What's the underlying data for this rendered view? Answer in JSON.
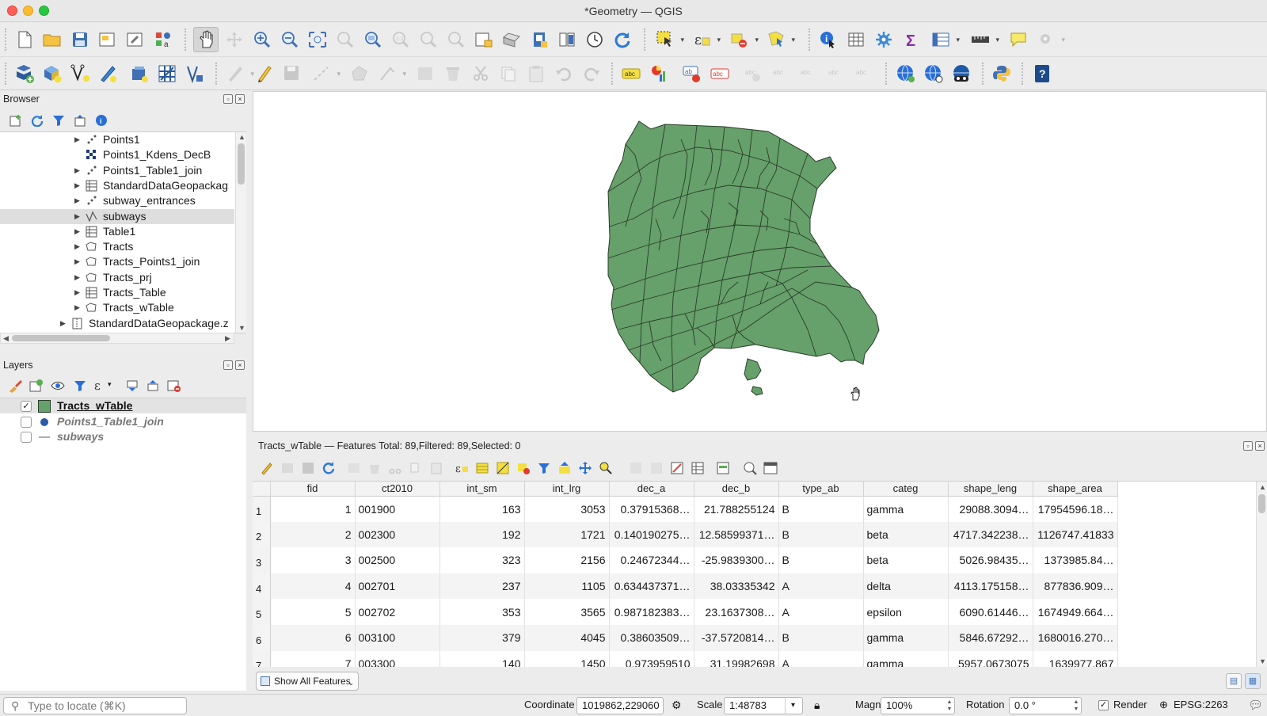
{
  "window": {
    "title": "*Geometry — QGIS"
  },
  "colors": {
    "polygon_fill": "#66a06a",
    "polygon_stroke": "#2a3d2a",
    "selection_bg": "#dedede",
    "accent": "#4a77b5"
  },
  "toolbar1": {
    "icons": [
      "new-project-icon",
      "open-project-icon",
      "save-project-icon",
      "new-print-layout-icon",
      "layout-manager-icon",
      "style-manager-icon",
      "pan-map-icon",
      "pan-to-selection-icon",
      "zoom-in-icon",
      "zoom-out-icon",
      "zoom-full-icon",
      "zoom-to-selection-icon",
      "zoom-to-layer-icon",
      "zoom-native-icon",
      "zoom-last-icon",
      "zoom-next-icon",
      "new-bookmark-icon",
      "show-bookmarks-icon",
      "new-3d-view-icon",
      "map-tips-icon",
      "temporal-controller-icon",
      "refresh-icon",
      "select-features-icon",
      "select-by-expression-icon",
      "deselect-icon",
      "select-by-location-icon",
      "identify-icon",
      "open-attribute-table-icon",
      "processing-toolbox-icon",
      "statistics-icon",
      "field-calculator-icon",
      "measure-icon",
      "annotation-icon",
      "settings-icon"
    ]
  },
  "toolbar2": {
    "icons": [
      "data-source-manager-icon",
      "new-geopackage-layer-icon",
      "add-vector-layer-icon",
      "digitize-icon",
      "new-virtual-layer-icon",
      "add-raster-icon",
      "add-mesh-icon",
      "toggle-editing-icon",
      "current-edits-icon",
      "save-edits-icon",
      "digitize-with-segment-icon",
      "add-polygon-icon",
      "vertex-tool-icon",
      "modify-attributes-icon",
      "delete-selected-icon",
      "cut-features-icon",
      "copy-features-icon",
      "paste-features-icon",
      "undo-icon",
      "redo-icon",
      "label-toolbar-icon",
      "diagram-icon",
      "highlight-label-icon",
      "label-pin-icon",
      "show-hide-labels-icon",
      "move-label-icon",
      "rotate-label-icon",
      "change-label-icon",
      "metasearch-icon",
      "wms-search-icon",
      "quickmapservices-icon",
      "python-console-icon",
      "help-icon"
    ]
  },
  "browser": {
    "title": "Browser",
    "items": [
      {
        "label": "Points1",
        "icon": "points-layer-icon",
        "expandable": true,
        "indent": 1
      },
      {
        "label": "Points1_Kdens_DecB",
        "icon": "raster-layer-icon",
        "expandable": false,
        "indent": 1
      },
      {
        "label": "Points1_Table1_join",
        "icon": "points-layer-icon",
        "expandable": true,
        "indent": 1
      },
      {
        "label": "StandardDataGeopackag",
        "icon": "table-icon",
        "expandable": true,
        "indent": 1
      },
      {
        "label": "subway_entrances",
        "icon": "points-layer-icon",
        "expandable": true,
        "indent": 1
      },
      {
        "label": "subways",
        "icon": "line-layer-icon",
        "expandable": true,
        "indent": 1,
        "selected": true
      },
      {
        "label": "Table1",
        "icon": "table-icon",
        "expandable": true,
        "indent": 1
      },
      {
        "label": "Tracts",
        "icon": "polygon-layer-icon",
        "expandable": true,
        "indent": 1
      },
      {
        "label": "Tracts_Points1_join",
        "icon": "polygon-layer-icon",
        "expandable": true,
        "indent": 1
      },
      {
        "label": "Tracts_prj",
        "icon": "polygon-layer-icon",
        "expandable": true,
        "indent": 1
      },
      {
        "label": "Tracts_Table",
        "icon": "table-icon",
        "expandable": true,
        "indent": 1
      },
      {
        "label": "Tracts_wTable",
        "icon": "polygon-layer-icon",
        "expandable": true,
        "indent": 1
      },
      {
        "label": "StandardDataGeopackage.z",
        "icon": "zip-icon",
        "expandable": true,
        "indent": 0
      }
    ]
  },
  "layers": {
    "title": "Layers",
    "items": [
      {
        "label": "Tracts_wTable",
        "checked": true,
        "symbol": "polygon",
        "active": true
      },
      {
        "label": "Points1_Table1_join",
        "checked": false,
        "symbol": "point",
        "active": false
      },
      {
        "label": "subways",
        "checked": false,
        "symbol": "line",
        "active": false
      }
    ]
  },
  "attribute_table": {
    "title": "Tracts_wTable — Features Total: 89,Filtered: 89,Selected: 0",
    "columns": [
      "fid",
      "ct2010",
      "int_sm",
      "int_lrg",
      "dec_a",
      "dec_b",
      "type_ab",
      "categ",
      "shape_leng",
      "shape_area"
    ],
    "rows": [
      {
        "n": "1",
        "cells": [
          "1",
          "001900",
          "163",
          "3053",
          "0.37915368…",
          "21.788255124",
          "B",
          "gamma",
          "29088.3094…",
          "17954596.18…"
        ]
      },
      {
        "n": "2",
        "cells": [
          "2",
          "002300",
          "192",
          "1721",
          "0.140190275…",
          "12.58599371…",
          "B",
          "beta",
          "4717.342238…",
          "1126747.41833"
        ]
      },
      {
        "n": "3",
        "cells": [
          "3",
          "002500",
          "323",
          "2156",
          "0.24672344…",
          "-25.9839300…",
          "B",
          "beta",
          "5026.98435…",
          "1373985.84…"
        ]
      },
      {
        "n": "4",
        "cells": [
          "4",
          "002701",
          "237",
          "1105",
          "0.634437371…",
          "38.03335342",
          "A",
          "delta",
          "4113.175158…",
          "877836.909…"
        ]
      },
      {
        "n": "5",
        "cells": [
          "5",
          "002702",
          "353",
          "3565",
          "0.987182383…",
          "23.1637308…",
          "A",
          "epsilon",
          "6090.61446…",
          "1674949.664…"
        ]
      },
      {
        "n": "6",
        "cells": [
          "6",
          "003100",
          "379",
          "4045",
          "0.38603509…",
          "-37.5720814…",
          "B",
          "gamma",
          "5846.67292…",
          "1680016.270…"
        ]
      },
      {
        "n": "7",
        "cells": [
          "7",
          "003300",
          "140",
          "1450",
          "0.973959510",
          "31.19982698",
          "A",
          "gamma",
          "5957.0673075",
          "1639977.867"
        ]
      }
    ],
    "show_all_label": "Show All Features"
  },
  "status": {
    "locator_placeholder": "Type to locate (⌘K)",
    "coordinate_label": "Coordinate",
    "coordinate_value": "1019862,229060",
    "scale_label": "Scale",
    "scale_value": "1:48783",
    "magnifier_label": "Magnifier",
    "magnifier_value": "100%",
    "rotation_label": "Rotation",
    "rotation_value": "0.0 °",
    "render_label": "Render",
    "crs_label": "EPSG:2263"
  }
}
